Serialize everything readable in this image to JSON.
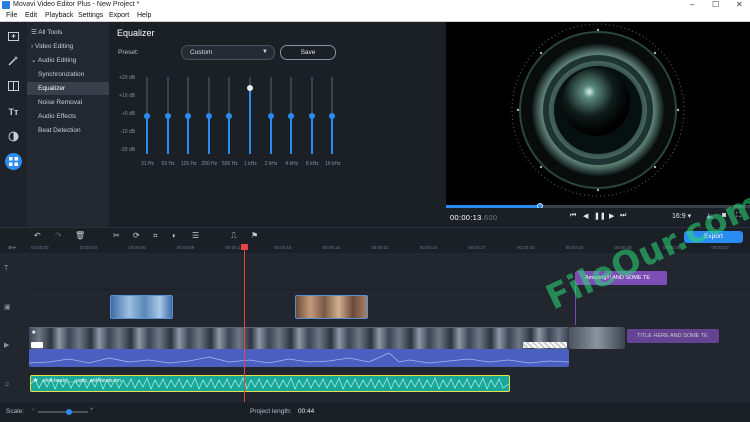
{
  "window": {
    "title": "Movavi Video Editor Plus - New Project *",
    "controls": [
      "–",
      "☐",
      "✕"
    ]
  },
  "menu": [
    "File",
    "Edit",
    "Playback",
    "Settings",
    "Export",
    "Help"
  ],
  "left_bar": {
    "icons": [
      "import-icon",
      "magic-wand-icon",
      "transitions-icon",
      "titles-icon",
      "filters-icon",
      "more-tools-icon"
    ]
  },
  "tools_panel": {
    "items": [
      {
        "label": "All Tools",
        "prefix": "☰"
      },
      {
        "label": "Video Editing",
        "prefix": "›"
      },
      {
        "label": "Audio Editing",
        "prefix": "⌄"
      },
      {
        "label": "Synchronization",
        "prefix": ""
      },
      {
        "label": "Equalizer",
        "prefix": ""
      },
      {
        "label": "Noise Removal",
        "prefix": ""
      },
      {
        "label": "Audio Effects",
        "prefix": ""
      },
      {
        "label": "Beat Detection",
        "prefix": ""
      }
    ],
    "selected_index": 4
  },
  "equalizer": {
    "title": "Equalizer",
    "preset_label": "Preset:",
    "preset_value": "Custom",
    "save_label": "Save",
    "db_labels": [
      "+20 dB",
      "+10 dB",
      "+0 dB",
      "-10 dB",
      "-20 dB"
    ],
    "bands": [
      {
        "freq": "31 Hz",
        "gain_db": 0
      },
      {
        "freq": "63 Hz",
        "gain_db": 0
      },
      {
        "freq": "125 Hz",
        "gain_db": 0
      },
      {
        "freq": "250 Hz",
        "gain_db": 0
      },
      {
        "freq": "500 Hz",
        "gain_db": 0
      },
      {
        "freq": "1 kHz",
        "gain_db": 15
      },
      {
        "freq": "2 kHz",
        "gain_db": 0
      },
      {
        "freq": "4 kHz",
        "gain_db": 0
      },
      {
        "freq": "8 kHz",
        "gain_db": 0
      },
      {
        "freq": "16 kHz",
        "gain_db": 0
      }
    ]
  },
  "player": {
    "timecode_main": "00:00:13",
    "timecode_ms": ".600",
    "progress": 0.31,
    "aspect": "16:9 ▾",
    "accent": "#2a8cf0"
  },
  "toolbar": {
    "export_label": "Export"
  },
  "ruler": {
    "ticks": [
      "00:00:00",
      "00:00:03",
      "00:00:06",
      "00:00:09",
      "00:00:12",
      "00:00:15",
      "00:00:18",
      "00:00:21",
      "00:00:24",
      "00:00:27",
      "00:00:30",
      "00:00:33",
      "00:00:36",
      "00:00:39",
      "00:00:42"
    ]
  },
  "timeline": {
    "title_clip_1": "Amazing!!! AND SOME TE",
    "title_clip_2": "TITLE HERE AND SOME TE",
    "audio_clip_label": "shot-beats_..._paris_with-beats-cm",
    "title_color": "#7b4db5",
    "audio_color": "#1aa89a"
  },
  "bottom": {
    "scale_label": "Scale:",
    "project_length_label": "Project length:",
    "project_length_value": "00:44"
  },
  "watermark": "FileOur.com"
}
